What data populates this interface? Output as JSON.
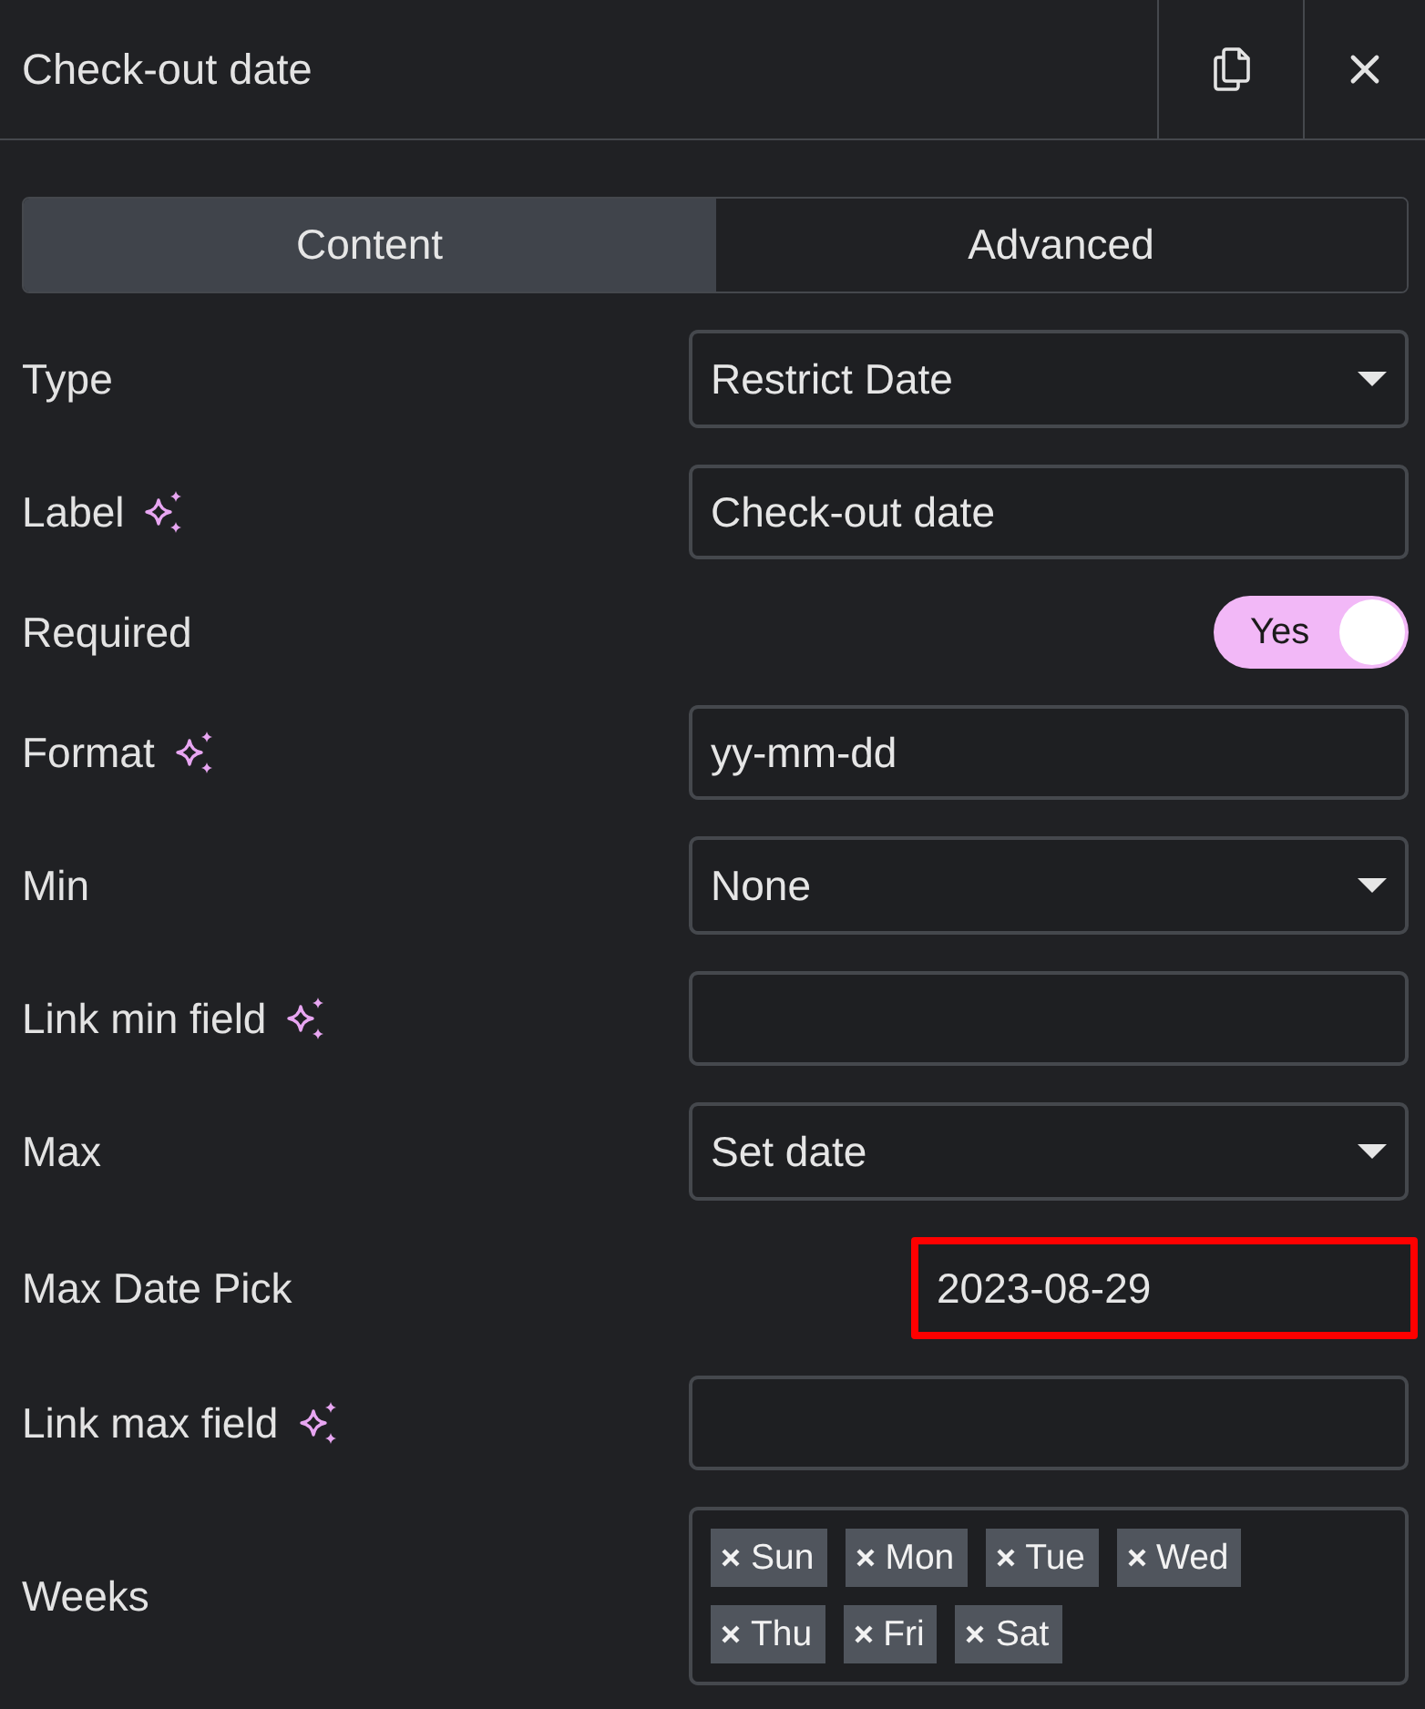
{
  "header": {
    "title": "Check-out date"
  },
  "tabs": [
    {
      "label": "Content",
      "selected": true
    },
    {
      "label": "Advanced",
      "selected": false
    }
  ],
  "fields": [
    {
      "kind": "select",
      "label": "Type",
      "ai": false,
      "highlighted": false,
      "value": "Restrict Date"
    },
    {
      "kind": "text",
      "label": "Label",
      "ai": true,
      "highlighted": false,
      "value": "Check-out date"
    },
    {
      "kind": "switch",
      "label": "Required",
      "ai": false,
      "highlighted": false,
      "on": true,
      "switch_label": "Yes"
    },
    {
      "kind": "text",
      "label": "Format",
      "ai": true,
      "highlighted": false,
      "value": "yy-mm-dd"
    },
    {
      "kind": "select",
      "label": "Min",
      "ai": false,
      "highlighted": false,
      "value": "None"
    },
    {
      "kind": "text",
      "label": "Link min field",
      "ai": true,
      "highlighted": false
    },
    {
      "kind": "select",
      "label": "Max",
      "ai": false,
      "highlighted": false,
      "value": "Set date"
    },
    {
      "kind": "date",
      "label": "Max Date Pick",
      "ai": false,
      "highlighted": true,
      "value": "2023-08-29"
    },
    {
      "kind": "text",
      "label": "Link max field",
      "ai": true,
      "highlighted": false
    },
    {
      "kind": "tags",
      "label": "Weeks",
      "ai": false,
      "highlighted": false,
      "tags": [
        "Sun",
        "Mon",
        "Tue",
        "Wed",
        "Thu",
        "Fri",
        "Sat"
      ]
    }
  ]
}
